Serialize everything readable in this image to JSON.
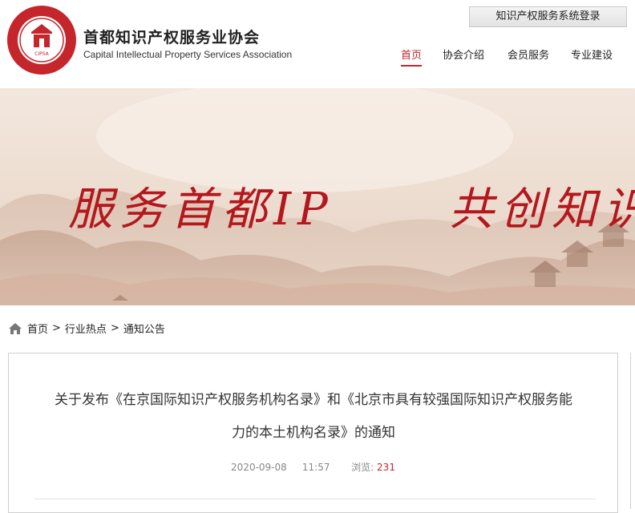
{
  "header": {
    "org_name_cn": "首都知识产权服务业协会",
    "org_name_en": "Capital Intellectual Property Services Association",
    "logo_text": "CIPSA",
    "logo_ring_text": "首都知识产权服务业协会",
    "login_button": "知识产权服务系统登录"
  },
  "nav": {
    "items": [
      {
        "label": "首页",
        "active": true
      },
      {
        "label": "协会介绍",
        "active": false
      },
      {
        "label": "会员服务",
        "active": false
      },
      {
        "label": "专业建设",
        "active": false
      }
    ]
  },
  "banner": {
    "slogan_1": "服务首都IP",
    "slogan_2": "共创知识"
  },
  "breadcrumb": {
    "items": [
      "首页",
      "行业热点",
      "通知公告"
    ],
    "separator": ">"
  },
  "article": {
    "title_line1": "关于发布《在京国际知识产权服务机构名录》和《北京市具有较强国际知识产权服务能",
    "title_line2": "力的本土机构名录》的通知",
    "date": "2020-09-08",
    "time": "11:57",
    "views_label": "浏览:",
    "views": "231"
  },
  "colors": {
    "brand_red": "#c4262c",
    "text": "#333333"
  }
}
